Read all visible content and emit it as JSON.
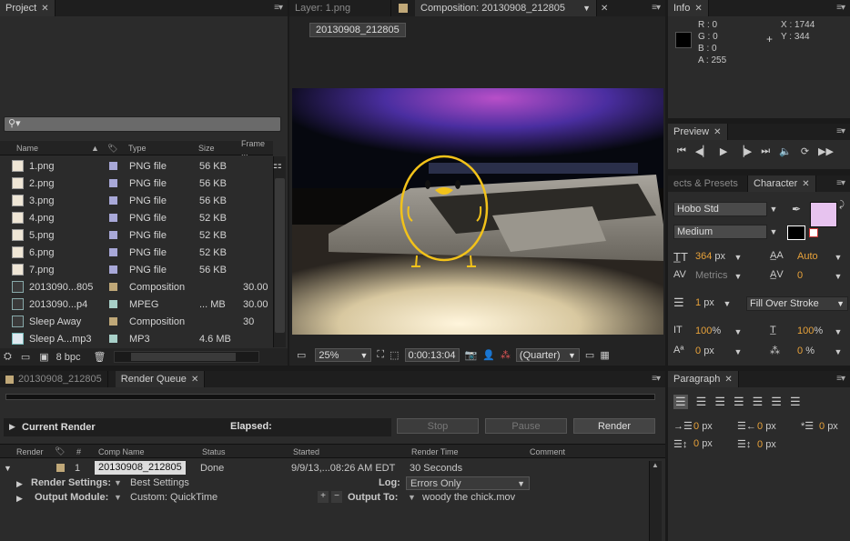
{
  "project": {
    "tab": "Project",
    "columns": [
      "Name",
      "Type",
      "Size",
      "Frame ..."
    ],
    "items": [
      {
        "name": "1.png",
        "type": "PNG file",
        "size": "56 KB",
        "frame": "",
        "icon": "png-file-icon",
        "label_color": "#a8a8d8"
      },
      {
        "name": "2.png",
        "type": "PNG file",
        "size": "56 KB",
        "frame": "",
        "icon": "png-file-icon",
        "label_color": "#a8a8d8"
      },
      {
        "name": "3.png",
        "type": "PNG file",
        "size": "56 KB",
        "frame": "",
        "icon": "png-file-icon",
        "label_color": "#a8a8d8"
      },
      {
        "name": "4.png",
        "type": "PNG file",
        "size": "52 KB",
        "frame": "",
        "icon": "png-file-icon",
        "label_color": "#a8a8d8"
      },
      {
        "name": "5.png",
        "type": "PNG file",
        "size": "52 KB",
        "frame": "",
        "icon": "png-file-icon",
        "label_color": "#a8a8d8"
      },
      {
        "name": "6.png",
        "type": "PNG file",
        "size": "52 KB",
        "frame": "",
        "icon": "png-file-icon",
        "label_color": "#a8a8d8"
      },
      {
        "name": "7.png",
        "type": "PNG file",
        "size": "56 KB",
        "frame": "",
        "icon": "png-file-icon",
        "label_color": "#a8a8d8"
      },
      {
        "name": "2013090...805",
        "type": "Composition",
        "size": "",
        "frame": "30.00",
        "icon": "composition-icon",
        "label_color": "#c0a878"
      },
      {
        "name": "2013090...p4",
        "type": "MPEG",
        "size": "... MB",
        "frame": "30.00",
        "icon": "video-file-icon",
        "label_color": "#a8d0c8"
      },
      {
        "name": "Sleep Away",
        "type": "Composition",
        "size": "",
        "frame": "30",
        "icon": "composition-icon",
        "label_color": "#c0a878"
      },
      {
        "name": "Sleep A...mp3",
        "type": "MP3",
        "size": "4.6 MB",
        "frame": "",
        "icon": "audio-file-icon",
        "label_color": "#a8d0c8"
      }
    ],
    "bpc": "8 bpc"
  },
  "viewer": {
    "layer_tab": "Layer: 1.png",
    "comp_tab": "Composition: 20130908_212805",
    "comp_name_tag": "20130908_212805",
    "zoom": "25%",
    "timecode": "0:00:13:04",
    "resolution": "(Quarter)"
  },
  "info": {
    "tab": "Info",
    "r": "R : 0",
    "g": "G : 0",
    "b": "B : 0",
    "a": "A : 255",
    "x": "X : 1744",
    "y": "Y : 344"
  },
  "preview": {
    "tab": "Preview"
  },
  "effects": {
    "tab": "ects & Presets"
  },
  "character": {
    "tab": "Character",
    "font": "Hobo Std",
    "style": "Medium",
    "size": "364",
    "size_unit": "px",
    "leading": "Auto",
    "kerning": "Metrics",
    "tracking": "0",
    "stroke": "1",
    "stroke_unit": "px",
    "stroke_type": "Fill Over Stroke",
    "vscale": "100",
    "hscale": "100",
    "pct": "%",
    "baseline": "0",
    "baseline_unit": "px",
    "tsume": "0",
    "tsume_unit": "%",
    "fill_color": "#e7c3ef"
  },
  "paragraph": {
    "tab": "Paragraph",
    "indent_left": "0",
    "indent_right": "0",
    "indent_first": "0",
    "space_before": "0",
    "space_after": "0",
    "unit": "px"
  },
  "render_queue": {
    "comp_tab": "20130908_212805",
    "tab": "Render Queue",
    "current_render": "Current Render",
    "elapsed": "Elapsed:",
    "stop": "Stop",
    "pause": "Pause",
    "render": "Render",
    "columns": {
      "render": "Render",
      "num": "#",
      "comp": "Comp Name",
      "status": "Status",
      "started": "Started",
      "rtime": "Render Time",
      "comment": "Comment"
    },
    "item": {
      "num": "1",
      "comp": "20130908_212805",
      "status": "Done",
      "started": "9/9/13,...08:26 AM EDT",
      "rtime": "30 Seconds",
      "render_settings_label": "Render Settings:",
      "render_settings": "Best Settings",
      "log_label": "Log:",
      "log": "Errors Only",
      "output_module_label": "Output Module:",
      "output_module": "Custom: QuickTime",
      "output_to_label": "Output To:",
      "output_to": "woody the chick.mov"
    }
  }
}
